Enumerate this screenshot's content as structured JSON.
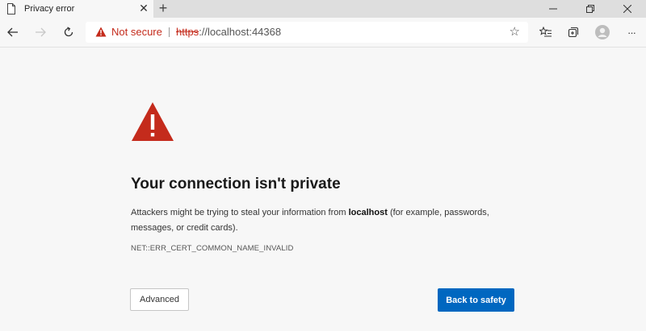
{
  "tab": {
    "title": "Privacy error",
    "close_glyph": "✕",
    "favicon": "page-icon"
  },
  "new_tab": {
    "glyph": "+"
  },
  "window_controls": {
    "minimize": "minimize-icon",
    "restore": "restore-icon",
    "close": "close-icon"
  },
  "toolbar": {
    "back": "back-arrow-icon",
    "forward": "forward-arrow-icon",
    "refresh": "refresh-icon",
    "favorites": "favorites-icon",
    "collections": "collections-icon",
    "profile": "profile-icon",
    "more_glyph": "···"
  },
  "omnibox": {
    "security_label": "Not secure",
    "url_scheme": "https",
    "url_rest": "://localhost:44368",
    "star_glyph": "☆"
  },
  "page": {
    "heading": "Your connection isn't private",
    "desc_before": "Attackers might be trying to steal your information from ",
    "desc_host": "localhost",
    "desc_after": " (for example, passwords, messages, or credit cards).",
    "error_code": "NET::ERR_CERT_COMMON_NAME_INVALID",
    "advanced_label": "Advanced",
    "back_label": "Back to safety"
  },
  "colors": {
    "warning_red": "#c42b1c",
    "primary_blue": "#0067c0",
    "page_background": "#f7f7f7"
  }
}
